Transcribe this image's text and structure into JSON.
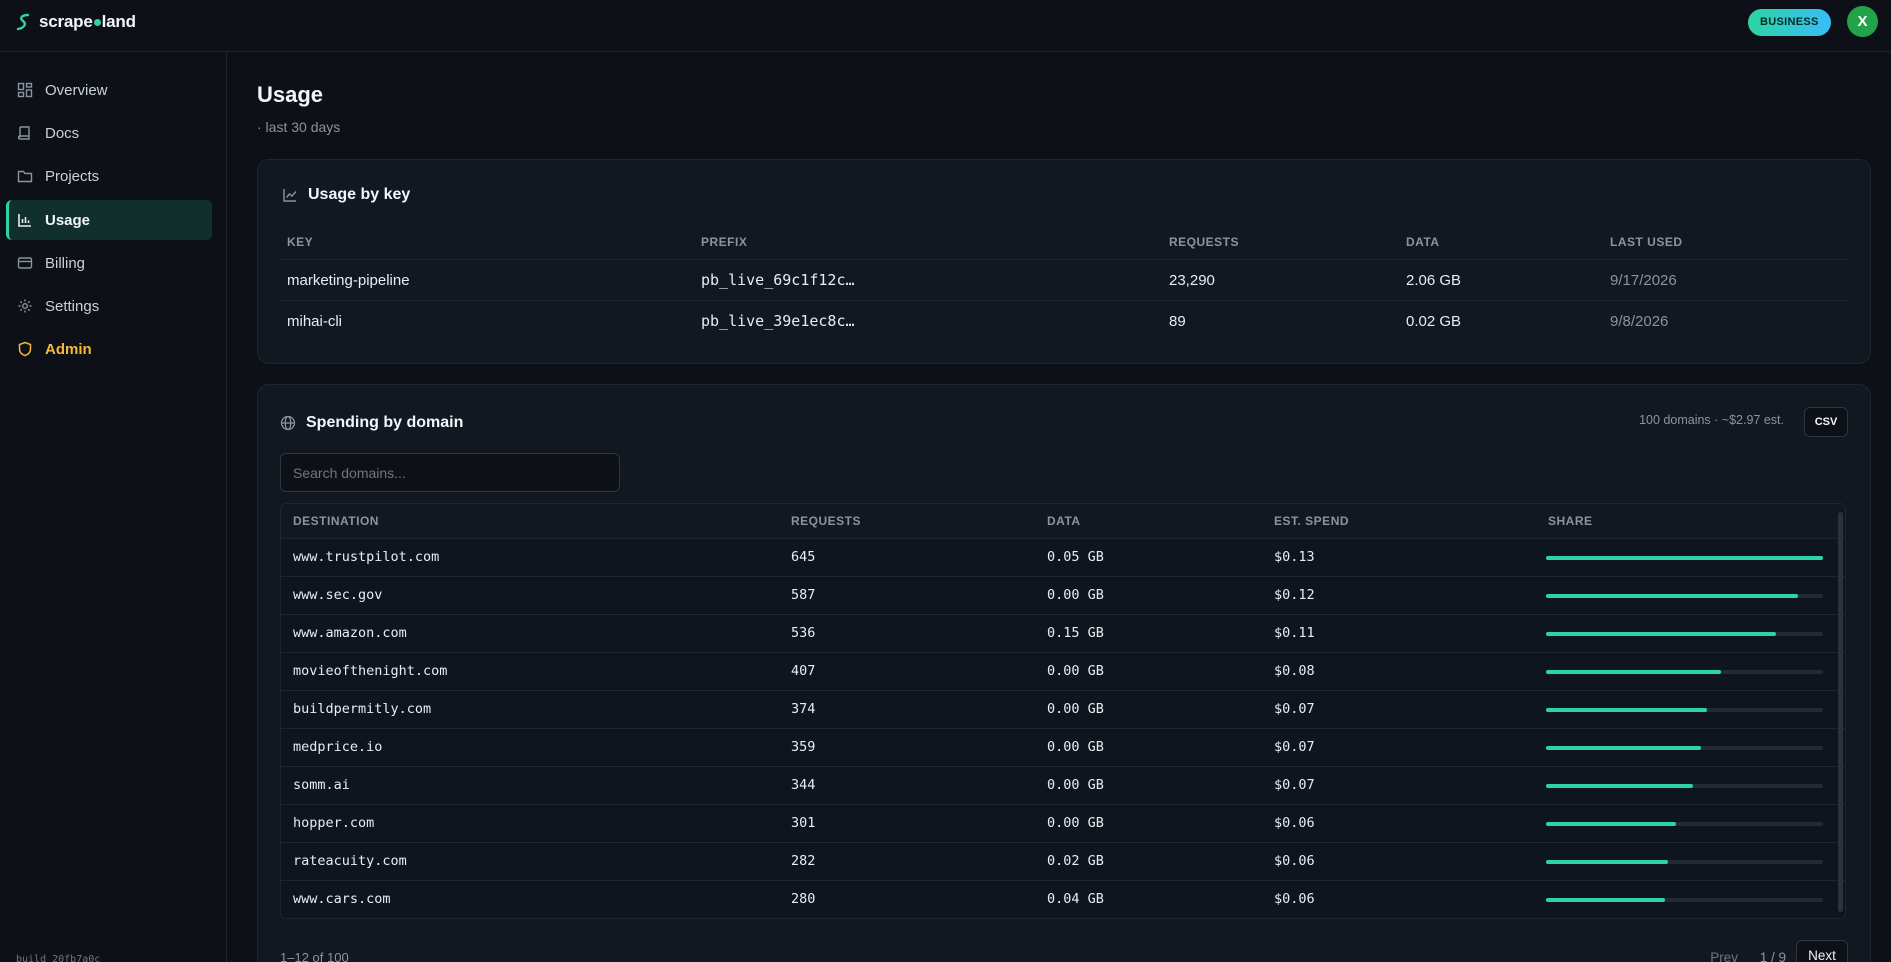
{
  "brand": {
    "name_part1": "scrape",
    "name_part2": "land"
  },
  "header": {
    "plan_badge": "BUSINESS",
    "avatar_initial": "X"
  },
  "sidebar": {
    "items": [
      {
        "label": "Overview",
        "icon": "grid-icon"
      },
      {
        "label": "Docs",
        "icon": "book-icon"
      },
      {
        "label": "Projects",
        "icon": "folder-icon"
      },
      {
        "label": "Usage",
        "icon": "bar-chart-icon",
        "active": true
      },
      {
        "label": "Billing",
        "icon": "credit-card-icon"
      },
      {
        "label": "Settings",
        "icon": "gear-icon"
      },
      {
        "label": "Admin",
        "icon": "shield-icon"
      }
    ],
    "build": "build 20fb7a0c"
  },
  "page": {
    "title": "Usage",
    "subtitle": "· last 30 days"
  },
  "usage_by_key": {
    "title": "Usage by key",
    "columns": [
      "KEY",
      "PREFIX",
      "REQUESTS",
      "DATA",
      "LAST USED"
    ],
    "rows": [
      {
        "key": "marketing-pipeline",
        "prefix": "pb_live_69c1f12c…",
        "requests": "23,290",
        "data": "2.06 GB",
        "last_used": "9/17/2026"
      },
      {
        "key": "mihai-cli",
        "prefix": "pb_live_39e1ec8c…",
        "requests": "89",
        "data": "0.02 GB",
        "last_used": "9/8/2026"
      }
    ]
  },
  "spending": {
    "title": "Spending by domain",
    "meta": "100 domains · ~$2.97 est.",
    "csv_label": "CSV",
    "search_placeholder": "Search domains...",
    "columns": [
      "DESTINATION",
      "REQUESTS",
      "DATA",
      "EST. SPEND",
      "SHARE"
    ],
    "rows": [
      {
        "destination": "www.trustpilot.com",
        "requests": "645",
        "data": "0.05 GB",
        "spend": "$0.13",
        "share": 1.0
      },
      {
        "destination": "www.sec.gov",
        "requests": "587",
        "data": "0.00 GB",
        "spend": "$0.12",
        "share": 0.91
      },
      {
        "destination": "www.amazon.com",
        "requests": "536",
        "data": "0.15 GB",
        "spend": "$0.11",
        "share": 0.83
      },
      {
        "destination": "movieofthenight.com",
        "requests": "407",
        "data": "0.00 GB",
        "spend": "$0.08",
        "share": 0.63
      },
      {
        "destination": "buildpermitly.com",
        "requests": "374",
        "data": "0.00 GB",
        "spend": "$0.07",
        "share": 0.58
      },
      {
        "destination": "medprice.io",
        "requests": "359",
        "data": "0.00 GB",
        "spend": "$0.07",
        "share": 0.56
      },
      {
        "destination": "somm.ai",
        "requests": "344",
        "data": "0.00 GB",
        "spend": "$0.07",
        "share": 0.53
      },
      {
        "destination": "hopper.com",
        "requests": "301",
        "data": "0.00 GB",
        "spend": "$0.06",
        "share": 0.47
      },
      {
        "destination": "rateacuity.com",
        "requests": "282",
        "data": "0.02 GB",
        "spend": "$0.06",
        "share": 0.44
      },
      {
        "destination": "www.cars.com",
        "requests": "280",
        "data": "0.04 GB",
        "spend": "$0.06",
        "share": 0.43
      }
    ],
    "pager": {
      "count": "1–12 of 100",
      "prev": "Prev",
      "page": "1 / 9",
      "next": "Next"
    }
  }
}
